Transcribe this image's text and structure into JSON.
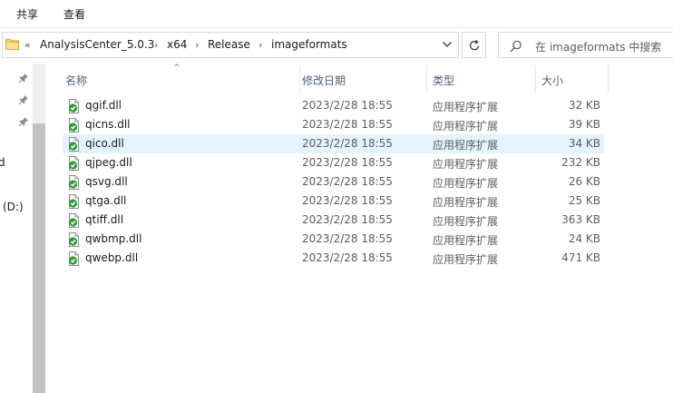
{
  "ribbon": {
    "tabs": [
      {
        "label": "共享"
      },
      {
        "label": "查看"
      }
    ]
  },
  "address": {
    "overflow": "«",
    "crumbs": [
      "AnalysisCenter_5.0.3",
      "x64",
      "Release",
      "imageformats"
    ]
  },
  "search": {
    "placeholder": "在 imageformats 中搜索"
  },
  "nav": {
    "items": [
      {
        "label": "d"
      },
      {
        "label": "(D:)"
      }
    ]
  },
  "columns": {
    "name": "名称",
    "modified": "修改日期",
    "type": "类型",
    "size": "大小"
  },
  "files": [
    {
      "name": "qgif.dll",
      "modified": "2023/2/28 18:55",
      "type": "应用程序扩展",
      "size": "32 KB"
    },
    {
      "name": "qicns.dll",
      "modified": "2023/2/28 18:55",
      "type": "应用程序扩展",
      "size": "39 KB"
    },
    {
      "name": "qico.dll",
      "modified": "2023/2/28 18:55",
      "type": "应用程序扩展",
      "size": "34 KB"
    },
    {
      "name": "qjpeg.dll",
      "modified": "2023/2/28 18:55",
      "type": "应用程序扩展",
      "size": "232 KB"
    },
    {
      "name": "qsvg.dll",
      "modified": "2023/2/28 18:55",
      "type": "应用程序扩展",
      "size": "26 KB"
    },
    {
      "name": "qtga.dll",
      "modified": "2023/2/28 18:55",
      "type": "应用程序扩展",
      "size": "25 KB"
    },
    {
      "name": "qtiff.dll",
      "modified": "2023/2/28 18:55",
      "type": "应用程序扩展",
      "size": "363 KB"
    },
    {
      "name": "qwbmp.dll",
      "modified": "2023/2/28 18:55",
      "type": "应用程序扩展",
      "size": "24 KB"
    },
    {
      "name": "qwebp.dll",
      "modified": "2023/2/28 18:55",
      "type": "应用程序扩展",
      "size": "471 KB"
    }
  ],
  "colors": {
    "selection": "#e5f3ff",
    "header_text": "#4c607a",
    "folder": "#f8d775",
    "dll_check": "#2e9a3a"
  },
  "icons": {
    "folder": "folder-icon",
    "file": "dll-file-icon",
    "refresh": "refresh-icon",
    "search": "search-icon",
    "pin": "pin-icon"
  }
}
